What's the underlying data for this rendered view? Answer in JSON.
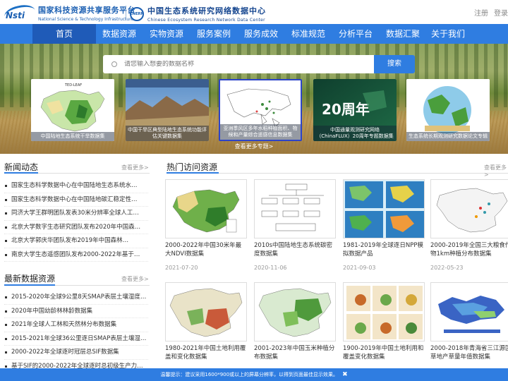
{
  "header": {
    "logo1_cn": "国家科技资源共享服务平台",
    "logo1_en": "National Science & Technology Infrastructure",
    "logo1_mark": "Nsti",
    "logo2_mark": "CNERN",
    "logo2_cn": "中国生态系统研究网络数据中心",
    "logo2_en": "Chinese Ecosystem Research Network Data Center",
    "register": "注册",
    "login": "登录"
  },
  "nav": [
    "首页",
    "数据资源",
    "实物资源",
    "服务案例",
    "服务成效",
    "标准规范",
    "分析平台",
    "数据汇聚",
    "关于我们"
  ],
  "search": {
    "placeholder": "请您输入想要的数据名称",
    "button": "搜索"
  },
  "banner": {
    "cards": [
      {
        "caption": "中国陆地生态系统干旱数据集",
        "label": "TED-LEAF"
      },
      {
        "caption": "中国干旱区典型陆地生态系统功能评估关键数据集",
        "label": ""
      },
      {
        "caption": "亚洲季风区多年水稻种植面积、物候和产量综合遥感信息数据集",
        "label": ""
      },
      {
        "caption": "中国通量观测研究网络（ChinaFLUX）20周年专题数据集",
        "label": "20周年"
      },
      {
        "caption": "生态系统长期观测研究数据论文专辑",
        "label": ""
      }
    ],
    "more": "查看更多专题>"
  },
  "news": {
    "title": "新闻动态",
    "more": "查看更多>",
    "items": [
      "国家生态科学数据中心在中国陆地生态系统水…",
      "国家生态科学数据中心在中国陆地碳汇稳定性…",
      "同济大学王群明团队发表30米分辨率全球人工…",
      "北京大学数字生态研究团队发布2020年中国森…",
      "北京大学郭庆华团队发布2019年中国森林…",
      "南京大学生态遥感团队发布2000-2022年基于…"
    ]
  },
  "latest": {
    "title": "最新数据资源",
    "more": "查看更多>",
    "items": [
      "2015-2020年全球9公里8天SMAP表层土壤湿度…",
      "2020年中国幼龄林林龄数据集",
      "2021年全球人工林和天然林分布数据集",
      "2015-2021年全球36公里逐日SMAP表层土壤湿…",
      "2000-2022年全球逐时冠层总SIF数据集",
      "基于SIF的2000-2022年全球逐时总初级生产力…"
    ]
  },
  "hot": {
    "title": "热门访问资源",
    "more": "查看更多>",
    "items": [
      {
        "name": "2000-2022年中国30米年最大NDVI数据集",
        "date": "2021-07-20"
      },
      {
        "name": "2010s中国陆地生态系统碳密度数据集",
        "date": "2020-11-06"
      },
      {
        "name": "1981-2019年全球逐日NPP模拟数据产品",
        "date": "2021-09-03"
      },
      {
        "name": "2000-2019年全国三大粮食作物1km种植分布数据集",
        "date": "2022-05-23"
      },
      {
        "name": "1980-2021年中国土地利用覆盖和变化数据集",
        "date": ""
      },
      {
        "name": "2001-2023年中国玉米种植分布数据集",
        "date": ""
      },
      {
        "name": "1900-2019年中国土地利用和覆盖变化数据集",
        "date": ""
      },
      {
        "name": "2000-2018年青海省三江源区草地产草量年值数据集",
        "date": ""
      }
    ]
  },
  "tip": {
    "text": "温馨提示：建议采用1600*900或以上的屏幕分辨率，以得到页面最佳显示效果。",
    "close": "✖"
  },
  "colors": {
    "brand_blue": "#2f7de1",
    "nav_active": "#1f5bb8"
  }
}
